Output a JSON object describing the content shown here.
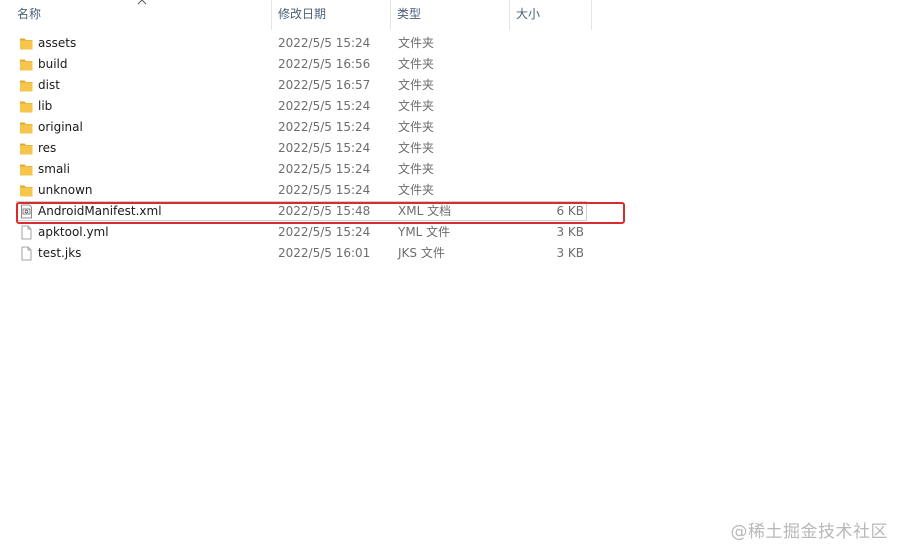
{
  "columns": {
    "name": "名称",
    "date": "修改日期",
    "type": "类型",
    "size": "大小"
  },
  "files": [
    {
      "name": "assets",
      "date": "2022/5/5 15:24",
      "type": "文件夹",
      "size": "",
      "icon": "folder-icon"
    },
    {
      "name": "build",
      "date": "2022/5/5 16:56",
      "type": "文件夹",
      "size": "",
      "icon": "folder-icon"
    },
    {
      "name": "dist",
      "date": "2022/5/5 16:57",
      "type": "文件夹",
      "size": "",
      "icon": "folder-icon"
    },
    {
      "name": "lib",
      "date": "2022/5/5 15:24",
      "type": "文件夹",
      "size": "",
      "icon": "folder-icon"
    },
    {
      "name": "original",
      "date": "2022/5/5 15:24",
      "type": "文件夹",
      "size": "",
      "icon": "folder-icon"
    },
    {
      "name": "res",
      "date": "2022/5/5 15:24",
      "type": "文件夹",
      "size": "",
      "icon": "folder-icon"
    },
    {
      "name": "smali",
      "date": "2022/5/5 15:24",
      "type": "文件夹",
      "size": "",
      "icon": "folder-icon"
    },
    {
      "name": "unknown",
      "date": "2022/5/5 15:24",
      "type": "文件夹",
      "size": "",
      "icon": "folder-icon"
    },
    {
      "name": "AndroidManifest.xml",
      "date": "2022/5/5 15:48",
      "type": "XML 文档",
      "size": "6 KB",
      "icon": "xml-file-icon",
      "selected": true
    },
    {
      "name": "apktool.yml",
      "date": "2022/5/5 15:24",
      "type": "YML 文件",
      "size": "3 KB",
      "icon": "file-icon"
    },
    {
      "name": "test.jks",
      "date": "2022/5/5 16:01",
      "type": "JKS 文件",
      "size": "3 KB",
      "icon": "file-icon"
    }
  ],
  "colors": {
    "folder": "#f5c64b",
    "folder_dark": "#e0a92e",
    "annotation": "#d92c2c",
    "header_text": "#4c607a"
  },
  "watermark": "@稀土掘金技术社区"
}
